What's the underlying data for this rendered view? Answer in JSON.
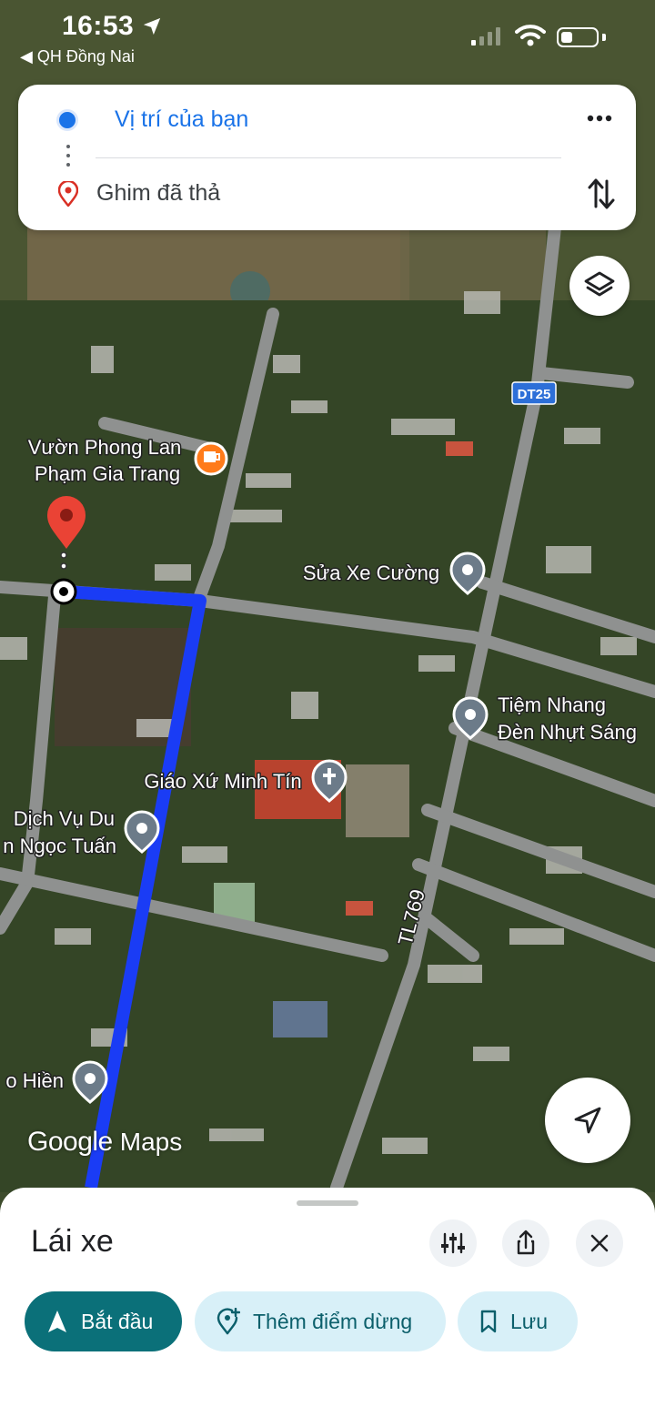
{
  "status_bar": {
    "time": "16:53",
    "back_app": "◀ QH Đồng Nai"
  },
  "directions": {
    "origin": "Vị trí của bạn",
    "destination": "Ghim đã thả"
  },
  "map": {
    "places": [
      {
        "line1": "Vườn Phong Lan",
        "line2": "Phạm Gia Trang",
        "icon": "coffee-icon"
      },
      {
        "line1": "Sửa Xe Cường",
        "line2": "",
        "icon": "place-pin-icon"
      },
      {
        "line1": "Tiệm Nhang",
        "line2": "Đèn Nhựt Sáng",
        "icon": "place-pin-icon"
      },
      {
        "line1": "Giáo Xứ Minh Tín",
        "line2": "",
        "icon": "church-icon"
      },
      {
        "line1": "Dịch Vụ Du",
        "line2": "n Ngọc Tuấn",
        "icon": "place-pin-icon"
      },
      {
        "line1": "o Hiền",
        "line2": "",
        "icon": "place-pin-icon"
      }
    ],
    "road_shields": {
      "dt25": "DT25",
      "tl769": "TL769"
    },
    "watermark": {
      "google": "Google",
      "maps": "Maps"
    },
    "route_color": "#1a3cf5"
  },
  "sheet": {
    "mode_title": "Lái xe",
    "start_label": "Bắt đầu",
    "add_stop_label": "Thêm điểm dừng",
    "save_label": "Lưu"
  },
  "colors": {
    "accent_teal": "#0b7079",
    "pill_light": "#d8f0f8",
    "blue": "#1a73e8"
  }
}
